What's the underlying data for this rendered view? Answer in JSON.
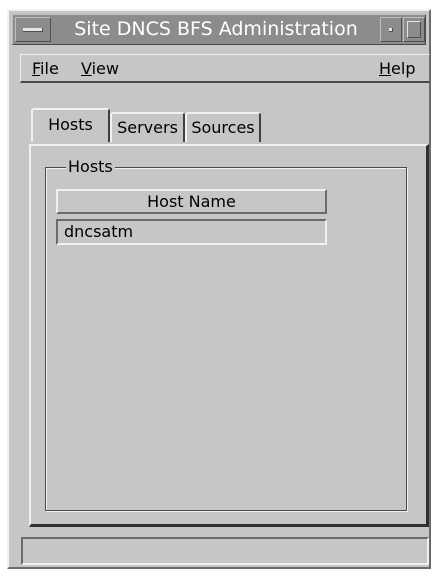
{
  "window": {
    "title": "Site DNCS BFS Administration"
  },
  "menubar": {
    "file": {
      "mnemonic": "F",
      "rest": "ile"
    },
    "view": {
      "mnemonic": "V",
      "rest": "iew"
    },
    "help": {
      "mnemonic": "H",
      "rest": "elp"
    }
  },
  "tabs": [
    {
      "label": "Hosts",
      "active": true
    },
    {
      "label": "Servers",
      "active": false
    },
    {
      "label": "Sources",
      "active": false
    }
  ],
  "hosts_panel": {
    "group_label": "Hosts",
    "column_header": "Host Name",
    "rows": [
      "dncsatm"
    ]
  },
  "statusbar": {
    "text": ""
  },
  "colors": {
    "background": "#c6c6c6",
    "titlebar": "#8c8c8c",
    "title_text": "#ffffff"
  }
}
